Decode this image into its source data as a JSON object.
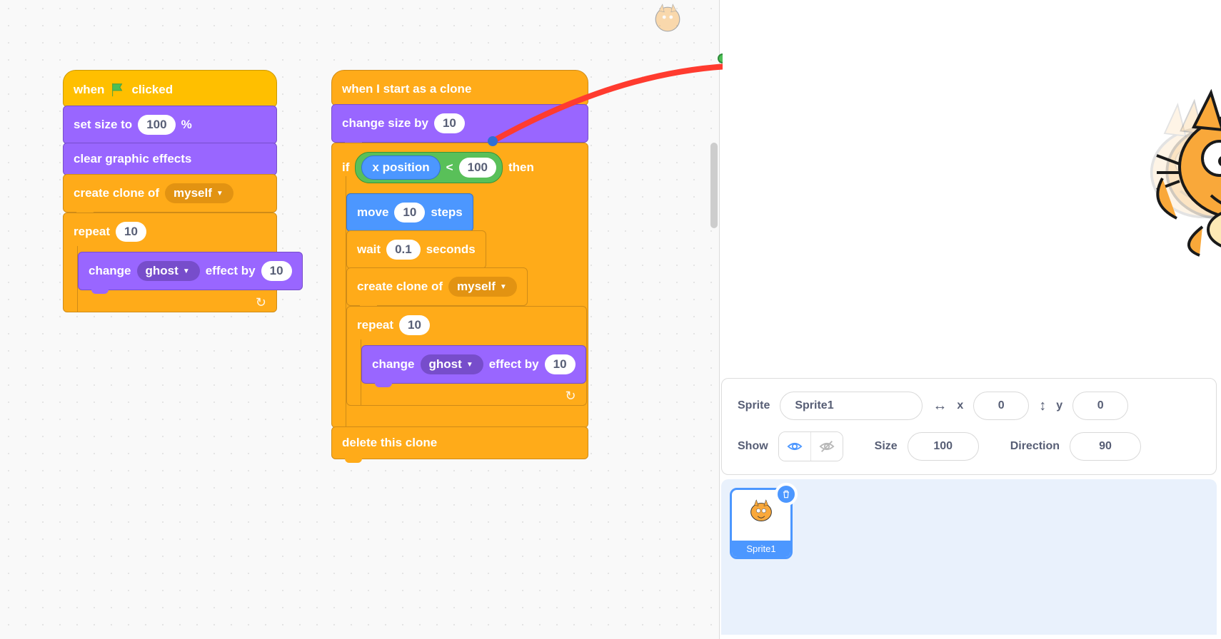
{
  "colors": {
    "events": "#ffbf00",
    "looks": "#9966ff",
    "control": "#ffab19",
    "motion": "#4c97ff",
    "operators": "#59c059",
    "accent": "#4c97ff"
  },
  "script1": {
    "hat": {
      "pre": "when",
      "post": "clicked"
    },
    "set_size": {
      "label_pre": "set size to",
      "value": "100",
      "label_post": "%"
    },
    "clear_fx": "clear graphic effects",
    "create_clone": {
      "label": "create clone of",
      "target": "myself"
    },
    "repeat": {
      "label": "repeat",
      "times": "10"
    },
    "change_fx": {
      "pre": "change",
      "effect": "ghost",
      "mid": "effect by",
      "value": "10"
    }
  },
  "script2": {
    "hat": "when I start as a clone",
    "change_size": {
      "label": "change size by",
      "value": "10"
    },
    "if": {
      "label": "if",
      "then": "then",
      "op": {
        "left": "x position",
        "cmp": "<",
        "right": "100"
      }
    },
    "move": {
      "pre": "move",
      "value": "10",
      "post": "steps"
    },
    "wait": {
      "pre": "wait",
      "value": "0.1",
      "post": "seconds"
    },
    "create_clone": {
      "label": "create clone of",
      "target": "myself"
    },
    "repeat": {
      "label": "repeat",
      "times": "10"
    },
    "change_fx": {
      "pre": "change",
      "effect": "ghost",
      "mid": "effect by",
      "value": "10"
    },
    "delete": "delete this clone"
  },
  "sprite_panel": {
    "sprite_label": "Sprite",
    "sprite_name": "Sprite1",
    "x_label": "x",
    "x_value": "0",
    "y_label": "y",
    "y_value": "0",
    "show_label": "Show",
    "size_label": "Size",
    "size_value": "100",
    "direction_label": "Direction",
    "direction_value": "90"
  },
  "sprites": [
    {
      "name": "Sprite1"
    }
  ]
}
